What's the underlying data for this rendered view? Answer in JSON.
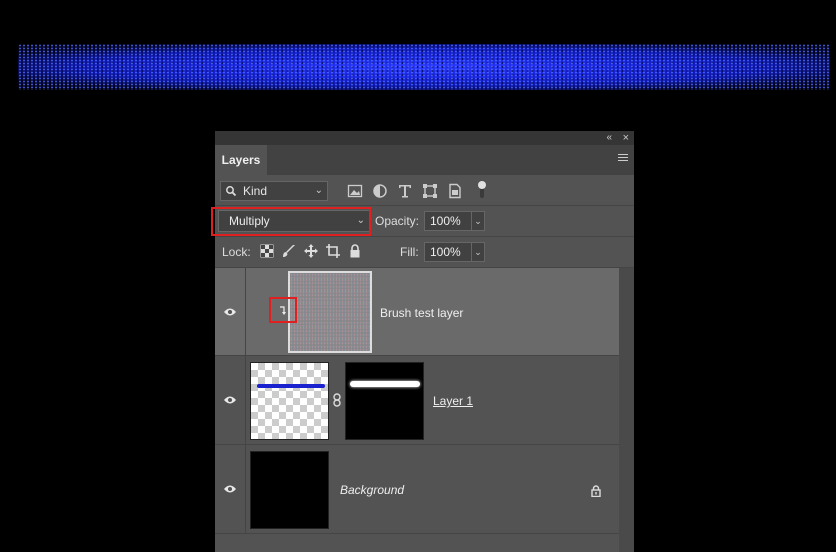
{
  "panel": {
    "collapse_glyph": "«",
    "close_glyph": "×",
    "tab_label": "Layers",
    "menu_icon": "panel-menu-icon"
  },
  "filter": {
    "kind_label": "Kind",
    "icons": [
      "image-filter-icon",
      "adjustment-filter-icon",
      "type-filter-icon",
      "shape-filter-icon",
      "smart-object-filter-icon"
    ]
  },
  "blend": {
    "mode": "Multiply",
    "opacity_label": "Opacity:",
    "opacity_value": "100%"
  },
  "lock": {
    "label": "Lock:",
    "icons": [
      "lock-transparent-pixels-icon",
      "lock-image-pixels-icon",
      "lock-position-icon",
      "lock-artboard-icon",
      "lock-all-icon"
    ],
    "fill_label": "Fill:",
    "fill_value": "100%"
  },
  "layers": [
    {
      "name": "Brush test layer",
      "selected": true,
      "clipped": true
    },
    {
      "name": "Layer 1",
      "has_mask": true
    },
    {
      "name": "Background",
      "locked": true
    }
  ],
  "colors": {
    "panel_bg": "#535353",
    "selected_row": "#6a6a6a",
    "highlight": "#e02020",
    "stroke_blue": "#1a22d0"
  }
}
